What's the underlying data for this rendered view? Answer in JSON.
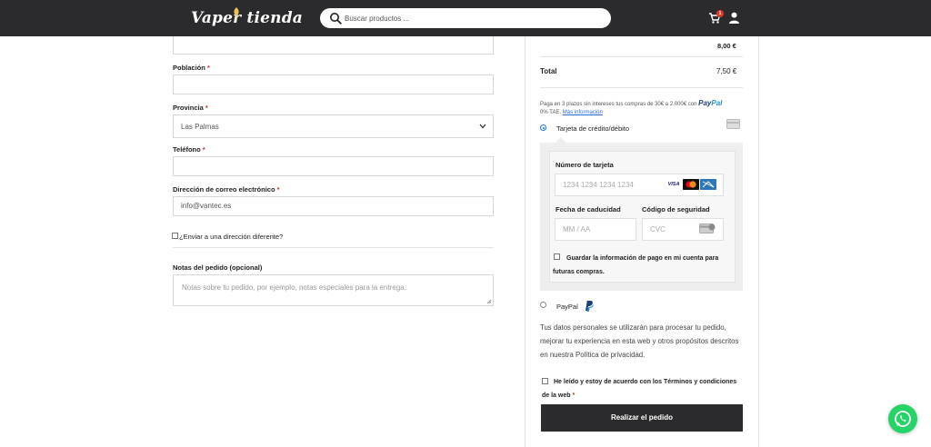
{
  "header": {
    "logo_text": "Vaper tienda",
    "search_placeholder": "Buscar productos ...",
    "cart_count": "1",
    "colors": {
      "bar": "#2b2a2c",
      "badge": "#e0352b"
    }
  },
  "billing": {
    "poblacion_label": "Población",
    "provincia_label": "Provincia",
    "provincia_value": "Las Palmas",
    "telefono_label": "Teléfono",
    "email_label": "Dirección de correo electrónico",
    "email_value": "info@vantec.es",
    "required_mark": "*",
    "ship_different_label": "¿Enviar a una dirección diferente?",
    "notes_label": "Notas del pedido (opcional)",
    "notes_placeholder": "Notas sobre tu pedido, por ejemplo, notas especiales para la entrega."
  },
  "order": {
    "subtotal_value": "8,00 €",
    "total_label": "Total",
    "total_value": "7,50 €",
    "finance_text": "Paga en 3 plazos sin intereses tus compras de 30€ a 2.000€ con",
    "finance_brand_a": "Pay",
    "finance_brand_b": "Pal",
    "finance_tae": "0% TAE.",
    "finance_link": "Más información"
  },
  "payment": {
    "card_method_label": "Tarjeta de crédito/débito",
    "card_number_label": "Número de tarjeta",
    "card_number_placeholder": "1234 1234 1234 1234",
    "expiry_label": "Fecha de caducidad",
    "expiry_placeholder": "MM / AA",
    "cvc_label": "Código de seguridad",
    "cvc_placeholder": "CVC",
    "visa_label": "VISA",
    "save_label": "Guardar la información de pago en mi cuenta para futuras compras.",
    "paypal_label": "PayPal",
    "selected_method": "card"
  },
  "privacy_text": "Tus datos personales se utilizarán para procesar tu pedido, mejorar tu experiencia en esta web y otros propósitos descritos en nuestra Política de privacidad.",
  "terms": {
    "label": "He leído y estoy de acuerdo con los Términos y condiciones de la web",
    "required_mark": "*"
  },
  "place_order_label": "Realizar el pedido"
}
